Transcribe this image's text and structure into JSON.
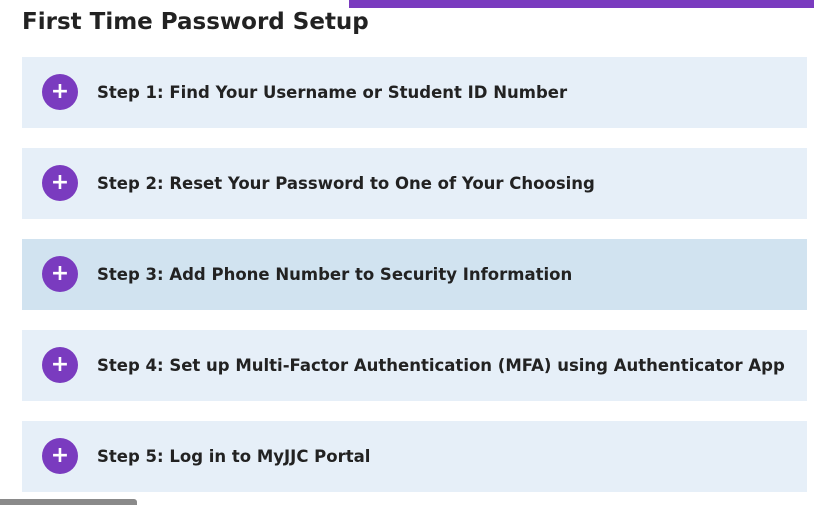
{
  "page": {
    "title": "First Time Password Setup"
  },
  "accordion": {
    "expand_icon": "plus-icon",
    "expand_glyph": "+",
    "items": [
      {
        "label": "Step 1: Find Your Username or Student ID Number"
      },
      {
        "label": "Step 2: Reset Your Password to One of Your Choosing"
      },
      {
        "label": "Step 3: Add Phone Number to Security Information",
        "highlighted": true
      },
      {
        "label": "Step 4: Set up Multi-Factor Authentication (MFA) using Authenticator App"
      },
      {
        "label": "Step 5: Log in to MyJJC Portal"
      }
    ]
  },
  "colors": {
    "accent": "#7a3bbf",
    "panel_bg": "#e6eff8",
    "panel_hover_bg": "#d1e3f0",
    "text": "#222222"
  }
}
